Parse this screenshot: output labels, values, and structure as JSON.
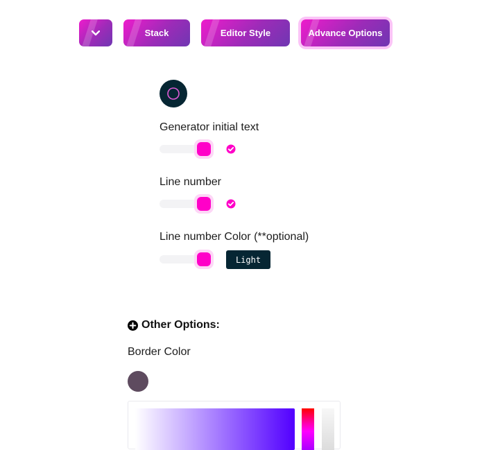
{
  "tabs": [
    {
      "id": "toggle",
      "icon": "chevron-down-icon",
      "label": ""
    },
    {
      "id": "stack",
      "label": "Stack"
    },
    {
      "id": "editor-style",
      "label": "Editor Style"
    },
    {
      "id": "advance-options",
      "label": "Advance Options",
      "active": true
    }
  ],
  "theme_icon": {
    "icon": "circle-outline-icon",
    "bg_color": "#062633",
    "ring_color": "#e05bd7"
  },
  "options": {
    "generator_initial_text": {
      "label": "Generator initial text",
      "enabled": true
    },
    "line_number": {
      "label": "Line number",
      "enabled": true
    },
    "line_number_color": {
      "label": "Line number Color (**optional)",
      "enabled": true,
      "value_label": "Light"
    }
  },
  "other_options": {
    "icon": "plus-circle-icon",
    "label": "Other Options:",
    "border_color": {
      "label": "Border Color",
      "swatch_color": "#5e4b5f",
      "picker_hue_color": "#5200ff"
    }
  },
  "colors": {
    "accent": "#ff00c8",
    "tab_gradient_start": "#ee1ccc",
    "tab_gradient_end": "#6f37b2",
    "dark": "#062633"
  }
}
